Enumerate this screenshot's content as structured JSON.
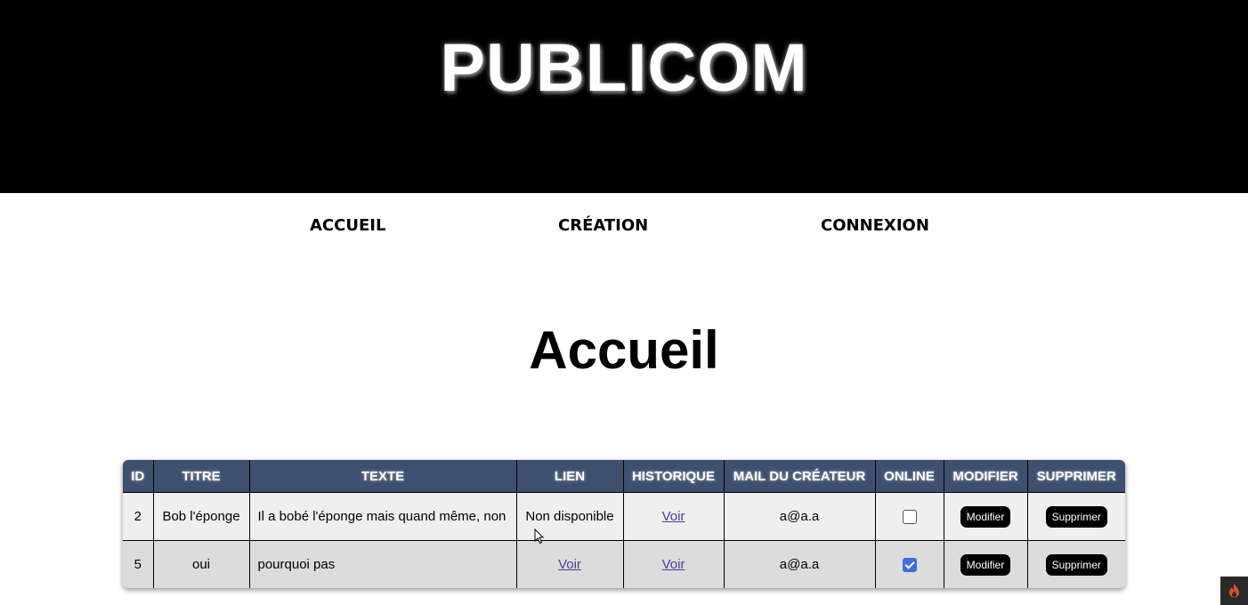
{
  "header": {
    "brand": "PUBLICOM"
  },
  "nav": {
    "items": [
      {
        "label": "ACCUEIL"
      },
      {
        "label": "CRÉATION"
      },
      {
        "label": "CONNEXION"
      }
    ]
  },
  "main": {
    "title": "Accueil"
  },
  "table": {
    "headers": [
      "ID",
      "TITRE",
      "TEXTE",
      "LIEN",
      "HISTORIQUE",
      "MAIL DU CRÉATEUR",
      "ONLINE",
      "MODIFIER",
      "SUPPRIMER"
    ],
    "rows": [
      {
        "id": "2",
        "titre": "Bob l'éponge",
        "texte": "Il a bobé l'éponge mais quand même, non",
        "lien": "Non disponible",
        "historique": "Voir",
        "mail": "a@a.a",
        "online": false,
        "modifier": "Modifier",
        "supprimer": "Supprimer"
      },
      {
        "id": "5",
        "titre": "oui",
        "texte": "pourquoi pas",
        "lien": "Voir",
        "historique": "Voir",
        "mail": "a@a.a",
        "online": true,
        "modifier": "Modifier",
        "supprimer": "Supprimer"
      }
    ]
  },
  "colors": {
    "header_bg": "#000000",
    "table_header_bg": "#3e5070",
    "checkbox_checked": "#3b6fe0",
    "link": "#4a3d9a"
  },
  "icons": {
    "corner_badge": "flame-icon",
    "cursor": "mouse-pointer-icon"
  }
}
